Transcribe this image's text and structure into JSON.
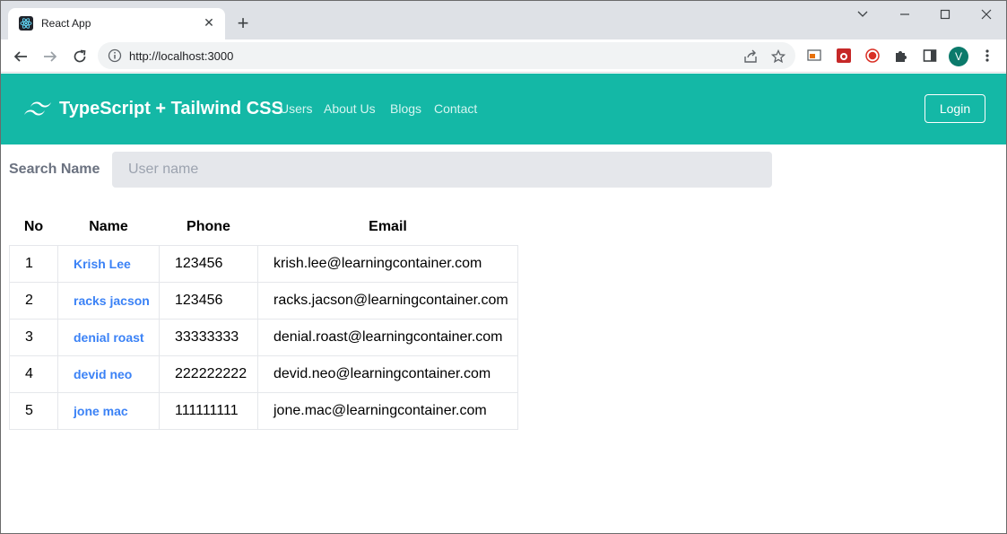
{
  "browser": {
    "tab_title": "React App",
    "tab_close": "✕",
    "new_tab": "+",
    "url": "http://localhost:3000",
    "profile_initial": "V"
  },
  "header": {
    "brand": "TypeScript + Tailwind CSS",
    "nav": [
      "Users",
      "About Us",
      "Blogs",
      "Contact"
    ],
    "login_label": "Login"
  },
  "search": {
    "label": "Search Name",
    "placeholder": "User name",
    "value": ""
  },
  "table": {
    "headers": [
      "No",
      "Name",
      "Phone",
      "Email"
    ],
    "rows": [
      {
        "no": "1",
        "name": "Krish Lee",
        "phone": "123456",
        "email": "krish.lee@learningcontainer.com"
      },
      {
        "no": "2",
        "name": "racks jacson",
        "phone": "123456",
        "email": "racks.jacson@learningcontainer.com"
      },
      {
        "no": "3",
        "name": "denial roast",
        "phone": "33333333",
        "email": "denial.roast@learningcontainer.com"
      },
      {
        "no": "4",
        "name": "devid neo",
        "phone": "222222222",
        "email": "devid.neo@learningcontainer.com"
      },
      {
        "no": "5",
        "name": "jone mac",
        "phone": "111111111",
        "email": "jone.mac@learningcontainer.com"
      }
    ]
  },
  "colors": {
    "header_bg": "#14b8a6",
    "link_blue": "#3b82f6",
    "input_bg": "#e5e7eb"
  }
}
